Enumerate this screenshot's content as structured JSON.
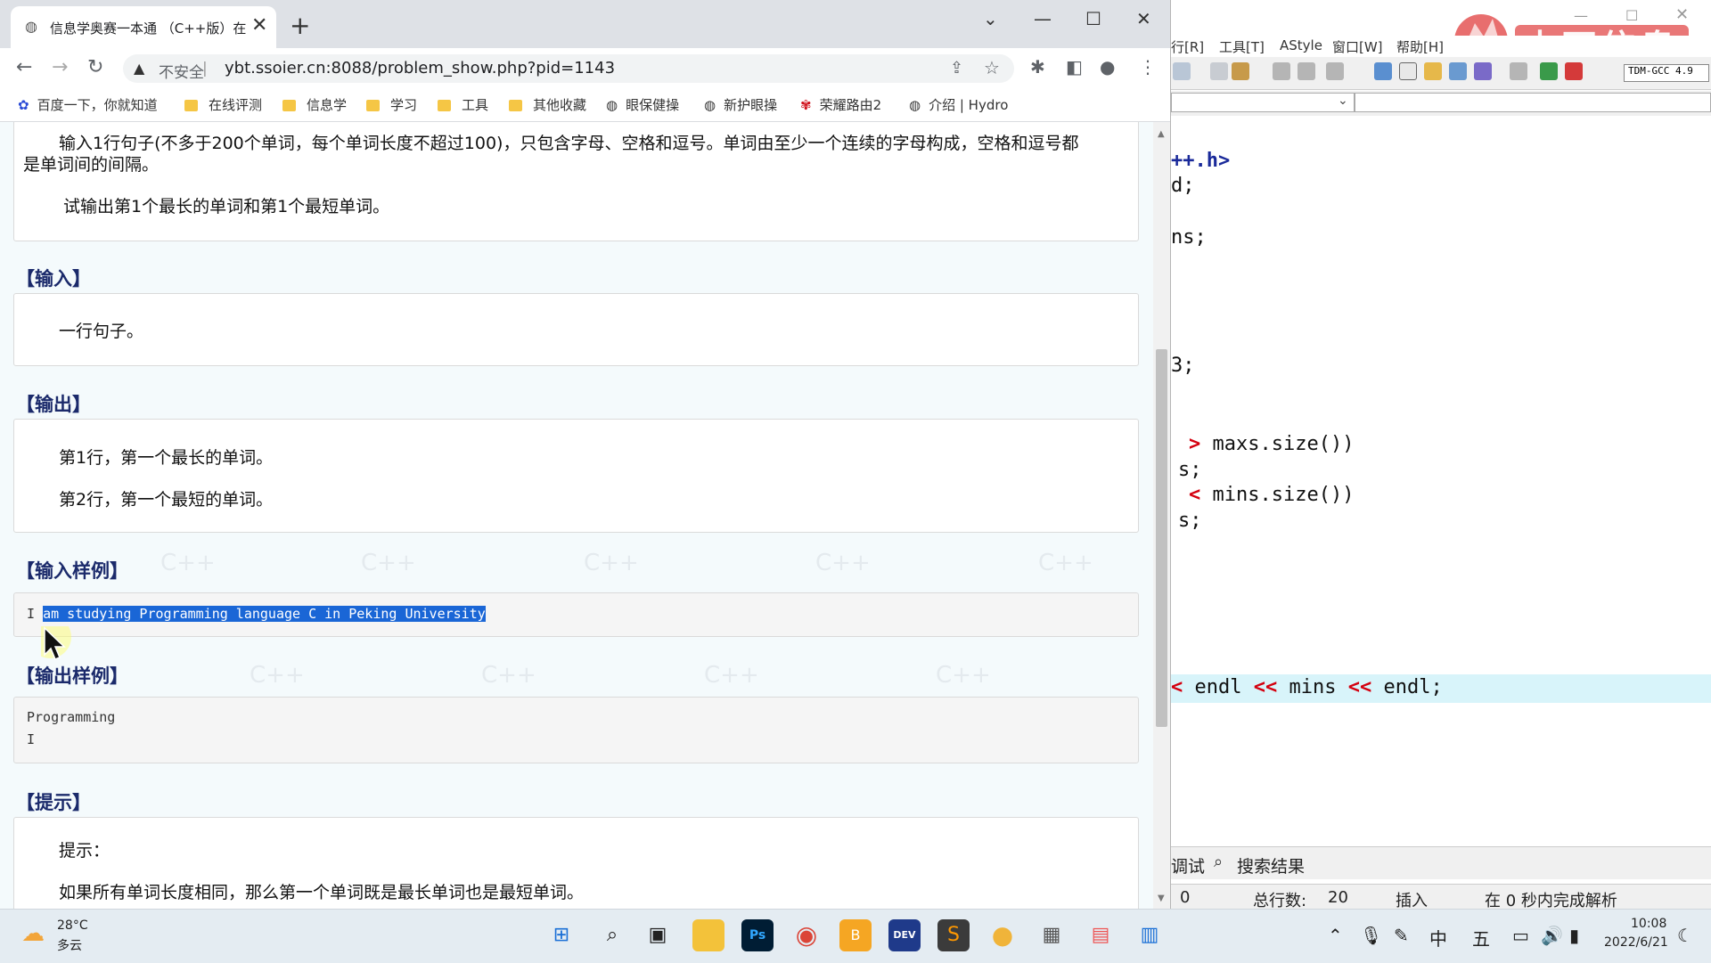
{
  "browser": {
    "tab_title": "信息学奥赛一本通 （C++版）在",
    "insecure_label": "不安全",
    "url": "ybt.ssoier.cn:8088/problem_show.php?pid=1143",
    "bookmarks": [
      "百度一下，你就知道",
      "在线评测",
      "信息学",
      "学习",
      "工具",
      "其他收藏",
      "眼保健操",
      "新护眼操",
      "荣耀路由2",
      "介绍 | Hydro"
    ]
  },
  "problem": {
    "desc_line1": "输入1行句子(不多于200个单词，每个单词长度不超过100)，只包含字母、空格和逗号。单词由至少一个连续的字母构成，空格和逗号都",
    "desc_line2": "是单词间的间隔。",
    "desc_line3": "试输出第1个最长的单词和第1个最短单词。",
    "input_heading": "【输入】",
    "input_text": "一行句子。",
    "output_heading": "【输出】",
    "output_line1": "第1行，第一个最长的单词。",
    "output_line2": "第2行，第一个最短的单词。",
    "sample_in_heading": "【输入样例】",
    "sample_in_first": "I ",
    "sample_in_selected": "am studying Programming language C in Peking University",
    "sample_out_heading": "【输出样例】",
    "sample_out_line1": "Programming",
    "sample_out_line2": "I",
    "hint_heading": "【提示】",
    "hint_label": "提示：",
    "hint_text": "如果所有单词长度相同，那么第一个单词既是最长单词也是最短单词。",
    "watermark": "C++"
  },
  "devcpp": {
    "menu": [
      "行[R]",
      "工具[T]",
      "AStyle",
      "窗口[W]",
      "帮助[H]"
    ],
    "compiler": "TDM-GCC 4.9",
    "logo_text": "木可信奥",
    "code": {
      "l1": "++.h>",
      "l2": "d;",
      "l3": "ns;",
      "l4": "3;",
      "l5_op": ">",
      "l5_rest": "maxs.size())",
      "l6": "s;",
      "l7_op": "<",
      "l7_rest": "mins.size())",
      "l8": "s;",
      "l9_a": "<",
      "l9_b": "endl",
      "l9_c": "<<",
      "l9_d": "mins",
      "l9_e": "<<",
      "l9_f": "endl;"
    },
    "tabs": {
      "debug": "调试",
      "search": "搜索结果"
    },
    "status": {
      "col": "0",
      "total_label": "总行数:",
      "total": "20",
      "mode": "插入",
      "parse": "在 0 秒内完成解析"
    }
  },
  "taskbar": {
    "weather_temp": "28°C",
    "weather_desc": "多云",
    "ime1": "中",
    "ime2": "五",
    "time": "10:08",
    "date": "2022/6/21"
  }
}
